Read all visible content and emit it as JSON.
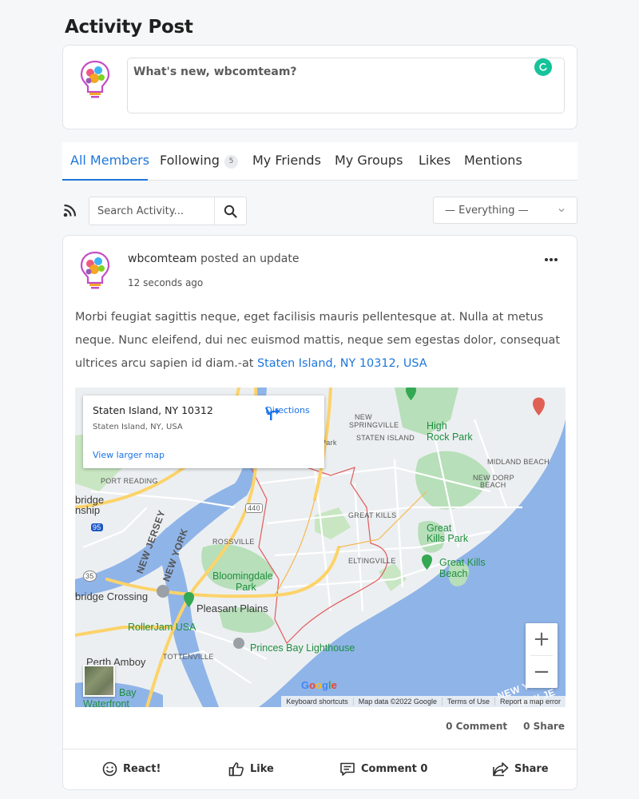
{
  "page": {
    "title": "Activity Post"
  },
  "composer": {
    "placeholder": "What's new, wbcomteam?"
  },
  "tabs": [
    {
      "label": "All Members",
      "active": true
    },
    {
      "label": "Following",
      "badge": "5"
    },
    {
      "label": "My Friends"
    },
    {
      "label": "My Groups"
    },
    {
      "label": "Likes"
    },
    {
      "label": "Mentions"
    }
  ],
  "filters": {
    "search_placeholder": "Search Activity...",
    "select_value": "— Everything —"
  },
  "post": {
    "author": "wbcomteam",
    "action": "posted an update",
    "time": "12 seconds ago",
    "body": "Morbi feugiat sagittis neque, eget facilisis mauris pellentesque at. Nulla at metus neque. Nunc eleifend, dui nec euismod mattis, neque sem egestas dolor, consequat ultrices arcu sapien id diam.-at ",
    "location_link": "Staten Island, NY 10312, USA",
    "stats": {
      "comments": "0 Comment",
      "shares": "0 Share"
    },
    "actions": {
      "react": "React!",
      "like": "Like",
      "comment": "Comment 0",
      "share": "Share"
    }
  },
  "map": {
    "card": {
      "title": "Staten Island, NY 10312",
      "subtitle": "Staten Island, NY, USA",
      "directions": "Directions",
      "larger_map": "View larger map"
    },
    "labels": {
      "new_springville": "NEW",
      "new_springville2": "SPRINGVILLE",
      "staten_island": "STATEN ISLAND",
      "high_rock": "High",
      "high_rock2": "Rock Park",
      "midland": "MIDLAND BEACH",
      "new_dorp": "NEW DORP",
      "new_dorp2": "BEACH",
      "port_reading": "PORT READING",
      "bridge": "bridge",
      "ship": "nship",
      "great_kills": "GREAT KILLS",
      "great_kills_park": "Great",
      "great_kills_park2": "Kills Park",
      "gk_beach": "Great Kills",
      "gk_beach2": "Beach",
      "rossville": "ROSSVILLE",
      "eltingville": "ELTINGVILLE",
      "bloomingdale": "Bloomingdale",
      "bloomingdale2": "Park",
      "new_jersey": "NEW JERSEY",
      "new_york": "NEW YORK",
      "crossing": "bridge Crossing",
      "pleasant_plains": "Pleasant Plains",
      "rollerjam": "RollerJam USA",
      "tottenville": "TOTTENVILLE",
      "lighthouse": "Princes Bay Lighthouse",
      "perth_amboy": "Perth Amboy",
      "bay": "Bay",
      "waterfront": "Waterfront",
      "new_york_sea": "NEW YORK",
      "new_je_sea": "NEW JE",
      "park_label": "Park",
      "shield_440": "440",
      "shield_95": "95",
      "shield_35": "35",
      "google": "Google"
    },
    "attribution": [
      "Keyboard shortcuts",
      "Map data ©2022 Google",
      "Terms of Use",
      "Report a map error"
    ],
    "zoom_in": "+",
    "zoom_out": "−"
  },
  "colors": {
    "accent": "#1d76da",
    "water": "#8fb4e8",
    "park": "#b7dfb9",
    "land": "#eceff1",
    "road_major": "#fcd36a"
  }
}
